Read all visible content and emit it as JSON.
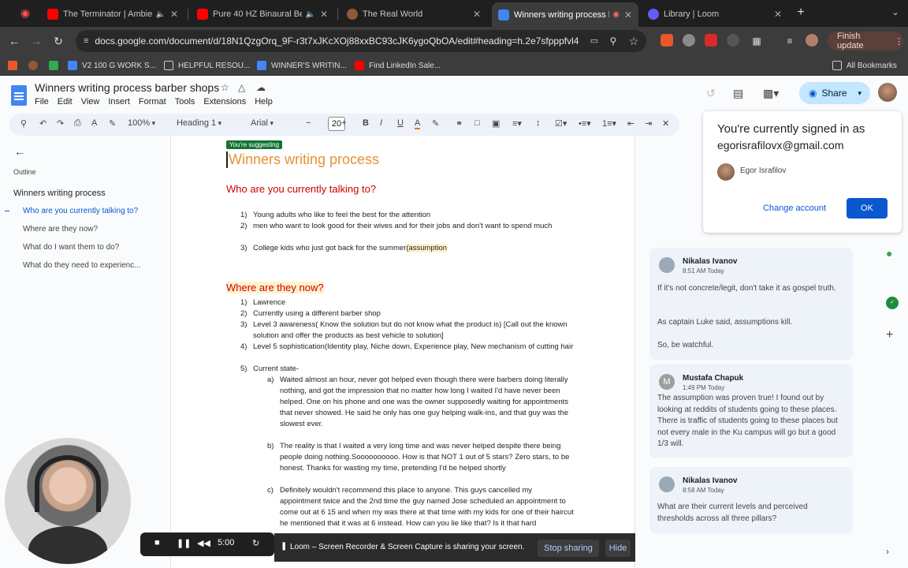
{
  "tabs": [
    {
      "title": "The Terminator | Ambient",
      "icon": "youtube-icon",
      "color": "#ff0000"
    },
    {
      "title": "Pure 40 HZ Binaural Beat",
      "icon": "youtube-icon",
      "color": "#ff0000"
    },
    {
      "title": "The Real World",
      "icon": "globe-icon",
      "color": "#8a5a3b"
    },
    {
      "title": "Winners writing process b",
      "icon": "docs-icon",
      "color": "#4285f4"
    },
    {
      "title": "Library | Loom",
      "icon": "loom-icon",
      "color": "#625df5"
    }
  ],
  "address": {
    "url": "docs.google.com/document/d/18N1QzgOrq_9F-r3t7xJKcXOj88xxBC93cJK6ygoQbOA/edit#heading=h.2e7sfpppfvl4"
  },
  "finish_update": "Finish update",
  "bookmarks": {
    "items": [
      "V2 100 G WORK S...",
      "HELPFUL RESOU...",
      "WINNER'S WRITIN...",
      "Find LinkedIn Sale..."
    ],
    "all": "All Bookmarks"
  },
  "doc": {
    "title": "Winners writing process barber shops",
    "menu": [
      "File",
      "Edit",
      "View",
      "Insert",
      "Format",
      "Tools",
      "Extensions",
      "Help"
    ],
    "share": "Share"
  },
  "toolbar": {
    "zoom": "100%",
    "style": "Heading 1",
    "font": "Arial",
    "size": "20"
  },
  "outline": {
    "label": "Outline",
    "items": [
      "Winners writing process",
      "Who are you currently talking to?",
      "Where are they now?",
      "What do I want them to do?",
      "What do they need to experienc..."
    ]
  },
  "page": {
    "badge": "You're suggesting",
    "title": "Winners writing process",
    "h_talking": "Who are you currently talking to?",
    "talking": [
      {
        "n": "1)",
        "t": "Young adults who like to feel the best for the attention"
      },
      {
        "n": "2)",
        "t": "men who want to look good for their wives and for their jobs and don't want to spend much"
      },
      {
        "n": "3)",
        "t": "College kids who just got back for the summer",
        "s": "(assumption"
      }
    ],
    "h_now": "Where are they now?",
    "now": [
      {
        "n": "1)",
        "t": "Lawrence"
      },
      {
        "n": "2)",
        "t": "Currently using a different barber shop"
      },
      {
        "n": "3)",
        "t": "Level 3 awareness( Know the solution but do not know what the product is) [Call out the known solution and offer the products as best vehicle to solution]"
      },
      {
        "n": "4)",
        "t": "Level 5 sophistication(Identity play, Niche down, Experience play, New mechanism of cutting hair"
      },
      {
        "n": "5)",
        "t": "Current state-"
      }
    ],
    "sub": [
      {
        "n": "a)",
        "t": " Waited almost an hour, never got helped even though there were barbers doing literally nothing, and got the impression that no matter how long I waited I'd have never been helped. One on his phone and one was the owner supposedly waiting for appointments that never showed. He said he only has one guy helping walk-ins, and that guy was the slowest ever."
      },
      {
        "n": "b)",
        "t": "The reality is that I waited a very long time and was never helped despite there being people doing nothing.Soooooooooo. How is that NOT 1 out of 5 stars? Zero stars, to be honest. Thanks for wasting my time, pretending I'd be helped shortly"
      },
      {
        "n": "c)",
        "t": "Definitely wouldn't recommend this place to anyone. This guys cancelled my appointment twice and the 2nd time the guy named Jose scheduled an appointment to come out at 6 15 and when my was there at that time with my kids for one of their haircut he mentioned that it was at 6 instead. How can you lie like that? Is it that hard"
      }
    ]
  },
  "signin": {
    "line1": "You're currently signed in as",
    "email": "egorisrafilovx@gmail.com",
    "name": "Egor Israfilov",
    "change": "Change account",
    "ok": "OK"
  },
  "comments": [
    {
      "name": "Nikalas Ivanov",
      "time": "8:51 AM Today",
      "body": [
        "If it's not concrete/legit, don't take it as gospel truth.",
        "As captain Luke said, assumptions kill.",
        "So, be watchful."
      ]
    },
    {
      "name": "Mustafa Chapuk",
      "initial": "M",
      "time": "1:49 PM Today",
      "body": [
        "The assumption was proven true! I found out by looking at reddits of students going to these places. There is traffic of students going to these places but not every male in the Ku campus will go but a good 1/3 will."
      ]
    },
    {
      "name": "Nikalas Ivanov",
      "time": "8:58 AM Today",
      "body": [
        "What are their current levels and perceived thresholds across all three pillars?"
      ]
    }
  ],
  "loom": {
    "timer": "5:00",
    "message": "Loom – Screen Recorder & Screen Capture is sharing your screen.",
    "stop": "Stop sharing",
    "hide": "Hide"
  }
}
